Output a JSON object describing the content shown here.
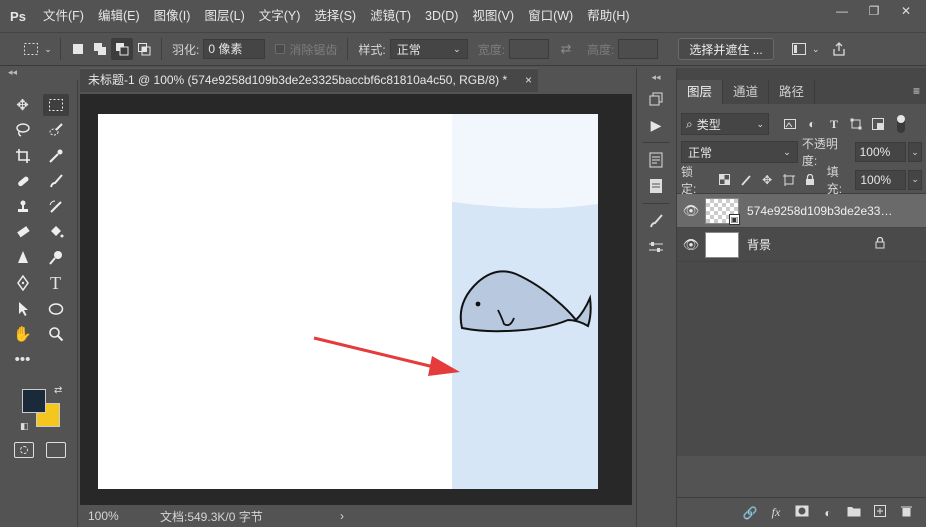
{
  "app": {
    "logo": "Ps",
    "menu": [
      "文件(F)",
      "编辑(E)",
      "图像(I)",
      "图层(L)",
      "文字(Y)",
      "选择(S)",
      "滤镜(T)",
      "3D(D)",
      "视图(V)",
      "窗口(W)",
      "帮助(H)"
    ],
    "window_controls": [
      "—",
      "❐",
      "✕"
    ]
  },
  "options": {
    "feather_label": "羽化:",
    "feather_value": "0 像素",
    "antialias_label": "消除锯齿",
    "style_label": "样式:",
    "style_value": "正常",
    "width_label": "宽度:",
    "height_label": "高度:",
    "select_mask_button": "选择并遮住 ..."
  },
  "toolbox": {
    "collapse": "◂◂",
    "tools": [
      [
        "move-tool-icon",
        "marquee-tool-icon"
      ],
      [
        "lasso-tool-icon",
        "quick-select-tool-icon"
      ],
      [
        "crop-tool-icon",
        "eyedropper-tool-icon"
      ],
      [
        "healing-brush-icon",
        "brush-tool-icon"
      ],
      [
        "clone-stamp-icon",
        "history-brush-icon"
      ],
      [
        "eraser-tool-icon",
        "paint-bucket-icon"
      ],
      [
        "blur-tool-icon",
        "dodge-tool-icon"
      ],
      [
        "pen-tool-icon",
        "type-tool-icon"
      ],
      [
        "path-select-icon",
        "ellipse-tool-icon"
      ],
      [
        "hand-tool-icon",
        "zoom-tool-icon"
      ],
      [
        "more-tools-icon"
      ]
    ],
    "foreground_color": "#1b2a3a",
    "background_color": "#f3c71e"
  },
  "document": {
    "tab_title": "未标题-1 @ 100% (574e9258d109b3de2e3325baccbf6c81810a4c50, RGB/8) *",
    "close": "×",
    "zoom": "100%",
    "doc_info": "文档:549.3K/0 字节",
    "status_arrow": "›"
  },
  "canvas": {
    "water_color": "#d6e6f6",
    "sky_color": "#f2f7fe",
    "whale_fill": "#b8c9df",
    "arrow_color": "#e53b3b"
  },
  "layers_panel": {
    "tabs": [
      "图层",
      "通道",
      "路径"
    ],
    "menu_icon": "≡",
    "filter_label": "类型",
    "blend_mode": "正常",
    "opacity_label": "不透明度:",
    "opacity_value": "100%",
    "lock_label": "锁定:",
    "fill_label": "填充:",
    "fill_value": "100%",
    "layers": [
      {
        "name": "574e9258d109b3de2e332...",
        "selected": true,
        "thumb": "checker"
      },
      {
        "name": "背景",
        "selected": false,
        "thumb": "white",
        "locked": true
      }
    ],
    "footer_icons": [
      "link-icon",
      "fx-icon",
      "mask-icon",
      "adjustment-icon",
      "group-icon",
      "new-layer-icon",
      "trash-icon"
    ]
  }
}
